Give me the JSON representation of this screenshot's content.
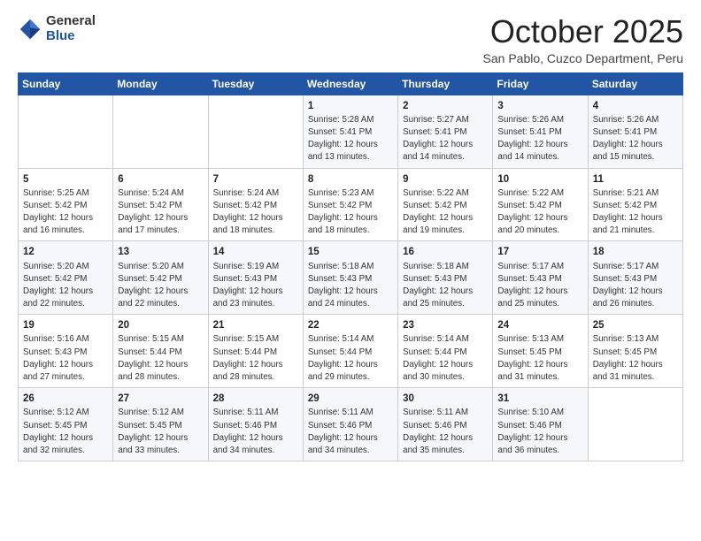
{
  "logo": {
    "general": "General",
    "blue": "Blue"
  },
  "header": {
    "month": "October 2025",
    "subtitle": "San Pablo, Cuzco Department, Peru"
  },
  "weekdays": [
    "Sunday",
    "Monday",
    "Tuesday",
    "Wednesday",
    "Thursday",
    "Friday",
    "Saturday"
  ],
  "weeks": [
    [
      {
        "day": "",
        "lines": []
      },
      {
        "day": "",
        "lines": []
      },
      {
        "day": "",
        "lines": []
      },
      {
        "day": "1",
        "lines": [
          "Sunrise: 5:28 AM",
          "Sunset: 5:41 PM",
          "Daylight: 12 hours",
          "and 13 minutes."
        ]
      },
      {
        "day": "2",
        "lines": [
          "Sunrise: 5:27 AM",
          "Sunset: 5:41 PM",
          "Daylight: 12 hours",
          "and 14 minutes."
        ]
      },
      {
        "day": "3",
        "lines": [
          "Sunrise: 5:26 AM",
          "Sunset: 5:41 PM",
          "Daylight: 12 hours",
          "and 14 minutes."
        ]
      },
      {
        "day": "4",
        "lines": [
          "Sunrise: 5:26 AM",
          "Sunset: 5:41 PM",
          "Daylight: 12 hours",
          "and 15 minutes."
        ]
      }
    ],
    [
      {
        "day": "5",
        "lines": [
          "Sunrise: 5:25 AM",
          "Sunset: 5:42 PM",
          "Daylight: 12 hours",
          "and 16 minutes."
        ]
      },
      {
        "day": "6",
        "lines": [
          "Sunrise: 5:24 AM",
          "Sunset: 5:42 PM",
          "Daylight: 12 hours",
          "and 17 minutes."
        ]
      },
      {
        "day": "7",
        "lines": [
          "Sunrise: 5:24 AM",
          "Sunset: 5:42 PM",
          "Daylight: 12 hours",
          "and 18 minutes."
        ]
      },
      {
        "day": "8",
        "lines": [
          "Sunrise: 5:23 AM",
          "Sunset: 5:42 PM",
          "Daylight: 12 hours",
          "and 18 minutes."
        ]
      },
      {
        "day": "9",
        "lines": [
          "Sunrise: 5:22 AM",
          "Sunset: 5:42 PM",
          "Daylight: 12 hours",
          "and 19 minutes."
        ]
      },
      {
        "day": "10",
        "lines": [
          "Sunrise: 5:22 AM",
          "Sunset: 5:42 PM",
          "Daylight: 12 hours",
          "and 20 minutes."
        ]
      },
      {
        "day": "11",
        "lines": [
          "Sunrise: 5:21 AM",
          "Sunset: 5:42 PM",
          "Daylight: 12 hours",
          "and 21 minutes."
        ]
      }
    ],
    [
      {
        "day": "12",
        "lines": [
          "Sunrise: 5:20 AM",
          "Sunset: 5:42 PM",
          "Daylight: 12 hours",
          "and 22 minutes."
        ]
      },
      {
        "day": "13",
        "lines": [
          "Sunrise: 5:20 AM",
          "Sunset: 5:42 PM",
          "Daylight: 12 hours",
          "and 22 minutes."
        ]
      },
      {
        "day": "14",
        "lines": [
          "Sunrise: 5:19 AM",
          "Sunset: 5:43 PM",
          "Daylight: 12 hours",
          "and 23 minutes."
        ]
      },
      {
        "day": "15",
        "lines": [
          "Sunrise: 5:18 AM",
          "Sunset: 5:43 PM",
          "Daylight: 12 hours",
          "and 24 minutes."
        ]
      },
      {
        "day": "16",
        "lines": [
          "Sunrise: 5:18 AM",
          "Sunset: 5:43 PM",
          "Daylight: 12 hours",
          "and 25 minutes."
        ]
      },
      {
        "day": "17",
        "lines": [
          "Sunrise: 5:17 AM",
          "Sunset: 5:43 PM",
          "Daylight: 12 hours",
          "and 25 minutes."
        ]
      },
      {
        "day": "18",
        "lines": [
          "Sunrise: 5:17 AM",
          "Sunset: 5:43 PM",
          "Daylight: 12 hours",
          "and 26 minutes."
        ]
      }
    ],
    [
      {
        "day": "19",
        "lines": [
          "Sunrise: 5:16 AM",
          "Sunset: 5:43 PM",
          "Daylight: 12 hours",
          "and 27 minutes."
        ]
      },
      {
        "day": "20",
        "lines": [
          "Sunrise: 5:15 AM",
          "Sunset: 5:44 PM",
          "Daylight: 12 hours",
          "and 28 minutes."
        ]
      },
      {
        "day": "21",
        "lines": [
          "Sunrise: 5:15 AM",
          "Sunset: 5:44 PM",
          "Daylight: 12 hours",
          "and 28 minutes."
        ]
      },
      {
        "day": "22",
        "lines": [
          "Sunrise: 5:14 AM",
          "Sunset: 5:44 PM",
          "Daylight: 12 hours",
          "and 29 minutes."
        ]
      },
      {
        "day": "23",
        "lines": [
          "Sunrise: 5:14 AM",
          "Sunset: 5:44 PM",
          "Daylight: 12 hours",
          "and 30 minutes."
        ]
      },
      {
        "day": "24",
        "lines": [
          "Sunrise: 5:13 AM",
          "Sunset: 5:45 PM",
          "Daylight: 12 hours",
          "and 31 minutes."
        ]
      },
      {
        "day": "25",
        "lines": [
          "Sunrise: 5:13 AM",
          "Sunset: 5:45 PM",
          "Daylight: 12 hours",
          "and 31 minutes."
        ]
      }
    ],
    [
      {
        "day": "26",
        "lines": [
          "Sunrise: 5:12 AM",
          "Sunset: 5:45 PM",
          "Daylight: 12 hours",
          "and 32 minutes."
        ]
      },
      {
        "day": "27",
        "lines": [
          "Sunrise: 5:12 AM",
          "Sunset: 5:45 PM",
          "Daylight: 12 hours",
          "and 33 minutes."
        ]
      },
      {
        "day": "28",
        "lines": [
          "Sunrise: 5:11 AM",
          "Sunset: 5:46 PM",
          "Daylight: 12 hours",
          "and 34 minutes."
        ]
      },
      {
        "day": "29",
        "lines": [
          "Sunrise: 5:11 AM",
          "Sunset: 5:46 PM",
          "Daylight: 12 hours",
          "and 34 minutes."
        ]
      },
      {
        "day": "30",
        "lines": [
          "Sunrise: 5:11 AM",
          "Sunset: 5:46 PM",
          "Daylight: 12 hours",
          "and 35 minutes."
        ]
      },
      {
        "day": "31",
        "lines": [
          "Sunrise: 5:10 AM",
          "Sunset: 5:46 PM",
          "Daylight: 12 hours",
          "and 36 minutes."
        ]
      },
      {
        "day": "",
        "lines": []
      }
    ]
  ]
}
